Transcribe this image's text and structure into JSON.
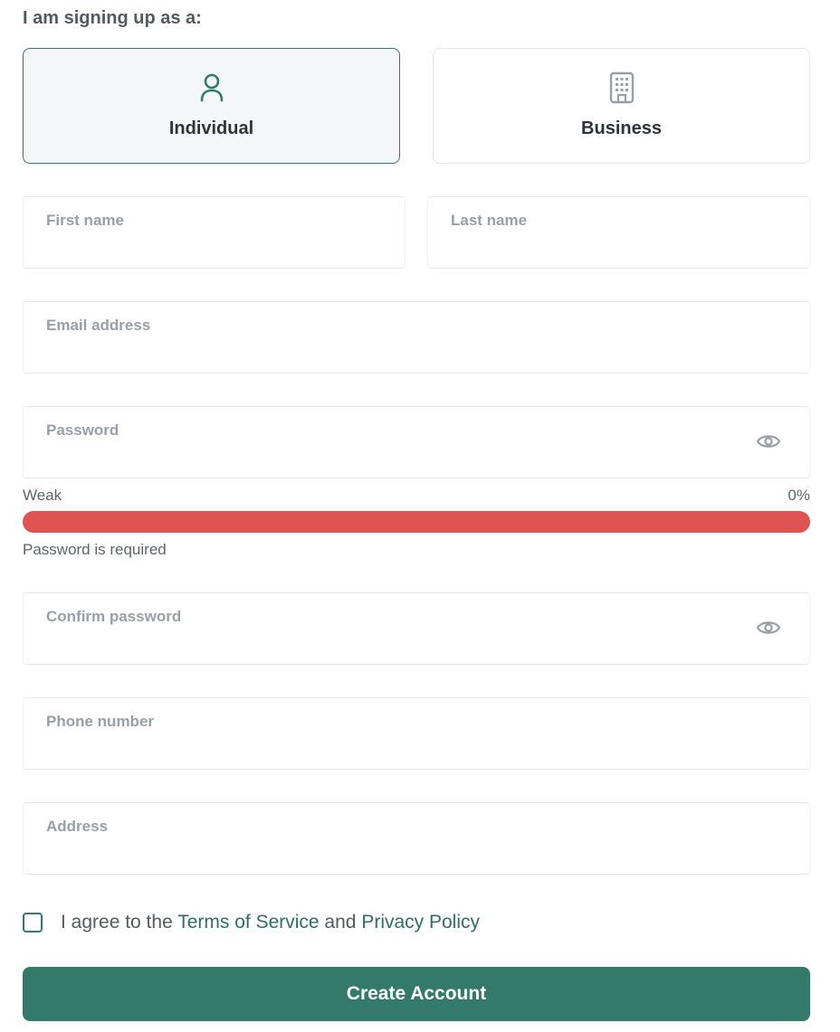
{
  "signup_type": {
    "prompt": "I am signing up as a:",
    "options": [
      {
        "label": "Individual",
        "icon": "user-icon",
        "selected": true
      },
      {
        "label": "Business",
        "icon": "building-icon",
        "selected": false
      }
    ]
  },
  "fields": {
    "first_name": {
      "label": "First name",
      "value": ""
    },
    "last_name": {
      "label": "Last name",
      "value": ""
    },
    "email": {
      "label": "Email address",
      "value": ""
    },
    "password": {
      "label": "Password",
      "value": "",
      "icon": "eye-icon"
    },
    "confirm_password": {
      "label": "Confirm password",
      "value": "",
      "icon": "eye-icon"
    },
    "phone": {
      "label": "Phone number",
      "value": ""
    },
    "address": {
      "label": "Address",
      "value": ""
    }
  },
  "password_strength": {
    "label": "Weak",
    "percent_text": "0%",
    "percent": 0,
    "error": "Password is required"
  },
  "agreement": {
    "checked": false,
    "prefix": "I agree to the ",
    "terms_link": "Terms of Service",
    "joiner": " and ",
    "privacy_link": "Privacy Policy"
  },
  "submit": {
    "label": "Create Account"
  },
  "colors": {
    "accent": "#347a6a",
    "strength_bar": "#df5350",
    "muted_label": "#9a9ea5",
    "text": "#2f3337"
  }
}
